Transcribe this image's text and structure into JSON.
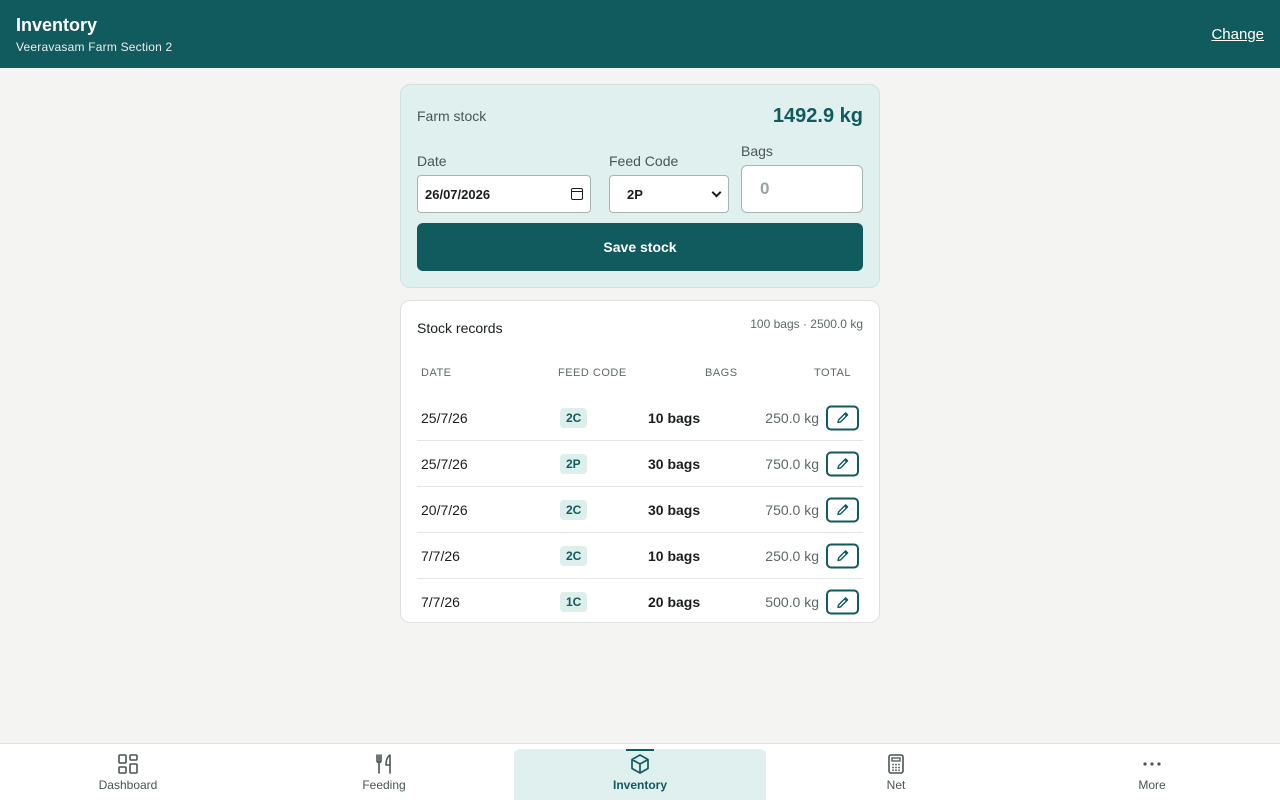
{
  "header": {
    "title": "Inventory",
    "subtitle": "Veeravasam Farm Section 2",
    "change_label": "Change"
  },
  "entry": {
    "farm_stock_label": "Farm stock",
    "farm_stock_value": "1492.9 kg",
    "date_label": "Date",
    "date_value": "26/07/2026",
    "feed_code_label": "Feed Code",
    "feed_code_value": "2P",
    "bags_label": "Bags",
    "bags_placeholder": "0",
    "save_label": "Save stock"
  },
  "records": {
    "title": "Stock records",
    "summary": "100 bags · 2500.0 kg",
    "columns": {
      "date": "DATE",
      "feed_code": "FEED CODE",
      "bags": "BAGS",
      "total": "TOTAL"
    },
    "rows": [
      {
        "date": "25/7/26",
        "code": "2C",
        "bags": "10 bags",
        "total": "250.0 kg"
      },
      {
        "date": "25/7/26",
        "code": "2P",
        "bags": "30 bags",
        "total": "750.0 kg"
      },
      {
        "date": "20/7/26",
        "code": "2C",
        "bags": "30 bags",
        "total": "750.0 kg"
      },
      {
        "date": "7/7/26",
        "code": "2C",
        "bags": "10 bags",
        "total": "250.0 kg"
      },
      {
        "date": "7/7/26",
        "code": "1C",
        "bags": "20 bags",
        "total": "500.0 kg"
      }
    ]
  },
  "nav": {
    "items": [
      {
        "label": "Dashboard",
        "icon": "grid-icon"
      },
      {
        "label": "Feeding",
        "icon": "fork-knife-icon"
      },
      {
        "label": "Inventory",
        "icon": "box-icon",
        "active": true
      },
      {
        "label": "Net",
        "icon": "calculator-icon"
      },
      {
        "label": "More",
        "icon": "more-dots-icon"
      }
    ]
  },
  "colors": {
    "primary": "#115a5e",
    "accent_bg": "#dff0ee",
    "page_bg": "#f4f5f2"
  }
}
